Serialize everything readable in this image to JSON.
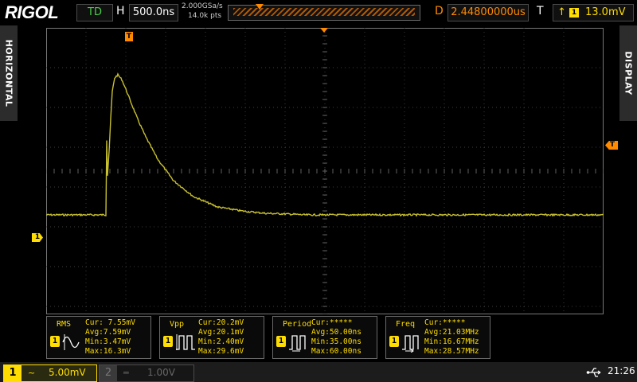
{
  "topbar": {
    "brand": "RIGOL",
    "run_state": "TD",
    "h_label": "H",
    "timebase": "500.0ns",
    "sample_rate": "2.000GSa/s",
    "memory_depth": "14.0k pts",
    "delay_label": "D",
    "delay": "2.44800000us",
    "trigger_label": "T",
    "trigger_channel": "1",
    "trigger_level": "13.0mV"
  },
  "side_tabs": {
    "left": "HORIZONTAL",
    "right": "DISPLAY"
  },
  "markers": {
    "trigger_pos": "T",
    "trigger_level": "T",
    "ch1_ground": "1"
  },
  "measurements": [
    {
      "name": "RMS",
      "channel": "1",
      "icon": "rms-wave-icon",
      "cur": "Cur: 7.55mV",
      "avg": "Avg:7.59mV",
      "min": "Min:3.47mV",
      "max": "Max:16.3mV"
    },
    {
      "name": "Vpp",
      "channel": "1",
      "icon": "vpp-pulse-icon",
      "cur": "Cur:20.2mV",
      "avg": "Avg:20.1mV",
      "min": "Min:2.40mV",
      "max": "Max:29.6mV"
    },
    {
      "name": "Period",
      "channel": "1",
      "icon": "period-pulse-icon",
      "cur": "Cur:*****",
      "avg": "Avg:50.00ns",
      "min": "Min:35.00ns",
      "max": "Max:60.00ns"
    },
    {
      "name": "Freq",
      "channel": "1",
      "icon": "freq-pulse-icon",
      "cur": "Cur:*****",
      "avg": "Avg:21.03MHz",
      "min": "Min:16.67MHz",
      "max": "Max:28.57MHz"
    }
  ],
  "bottombar": {
    "ch1": {
      "number": "1",
      "coupling": "~",
      "scale": "5.00mV"
    },
    "ch2": {
      "number": "2",
      "coupling": "═",
      "scale": "1.00V"
    },
    "time": "21:26"
  },
  "colors": {
    "ch1": "#ffdd00",
    "trace": "#c8c030",
    "orange": "#ff8a00",
    "green": "#4ccf4c",
    "grid": "#3c3c3c",
    "grid_dot": "#606060"
  },
  "waveform": {
    "samples_t_ns": [
      -1250,
      -500,
      -499,
      -498,
      -480,
      -460,
      -440,
      -420,
      -390,
      -350,
      -300,
      -250,
      -180,
      -100,
      0,
      150,
      350,
      600,
      900,
      1200,
      1500,
      1800,
      2000
    ],
    "samples_mv": [
      0,
      0,
      0,
      13,
      5,
      8,
      12,
      15.5,
      17.2,
      17.6,
      17,
      15.8,
      14,
      12,
      9.8,
      7,
      4.3,
      2.3,
      1,
      0.5,
      0.2,
      0.1,
      0
    ],
    "ch1_scale_mv_per_div": 5,
    "ground_offset_div": -1.1,
    "timebase_ns_per_div": 500
  }
}
